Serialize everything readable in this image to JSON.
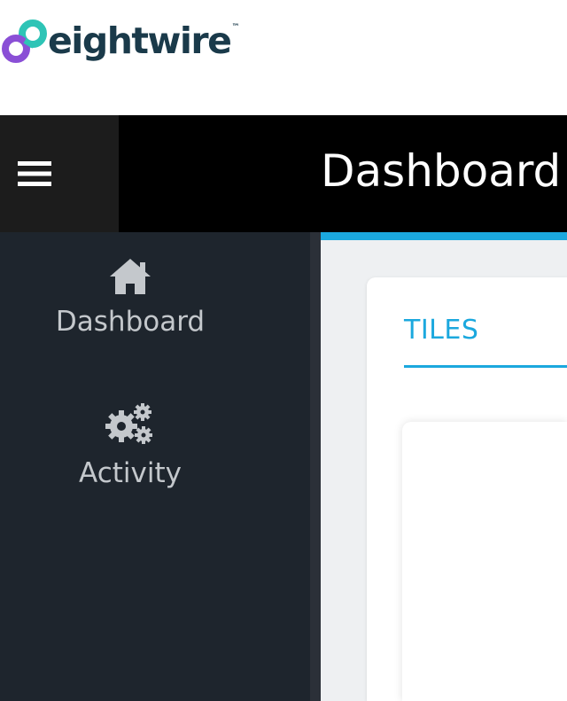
{
  "brand": {
    "logo_text": "eightwire",
    "trademark": "™",
    "colors": {
      "logo_teal": "#2ec4b6",
      "logo_purple": "#8a4fd6",
      "logo_text": "#1a3a4a"
    }
  },
  "header": {
    "menu_icon": "hamburger-icon",
    "title": "Dashboard"
  },
  "sidebar": {
    "items": [
      {
        "label": "Dashboard",
        "icon": "home-icon"
      },
      {
        "label": "Activity",
        "icon": "gears-icon"
      }
    ]
  },
  "main": {
    "tabs": [
      {
        "label": "TILES",
        "active": true
      }
    ]
  },
  "colors": {
    "accent": "#1ba8de",
    "header_bg": "#000000",
    "sidebar_bg": "#1e252d",
    "sidebar_text": "#c4c8cc"
  }
}
